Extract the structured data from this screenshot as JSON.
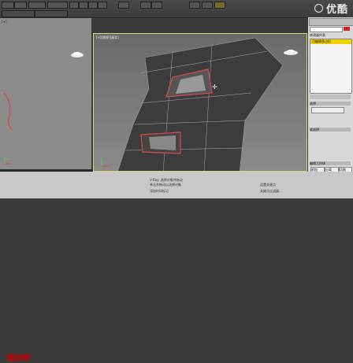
{
  "watermark": {
    "text": "优酷"
  },
  "logo": {
    "text": "瑞泽明"
  },
  "panel": {
    "header_label": "修改器列表",
    "stack_items": [
      "可编辑多边形"
    ],
    "subheads": [
      "选择",
      "软选择",
      "编辑几何体"
    ],
    "buttons": [
      "附加",
      "分离",
      "切割"
    ]
  },
  "status_bar": {
    "line1": "V-Ray: 选择对象并拖动",
    "line2": "单击并拖动以选择对象",
    "add_key": "添加时间标记",
    "set_key": "设置关键点",
    "key_filter": "关键点过滤器..."
  },
  "colors": {
    "viewport_border": "#d8d870",
    "selected_edge": "#d84a4a",
    "accent": "#f0d000"
  }
}
